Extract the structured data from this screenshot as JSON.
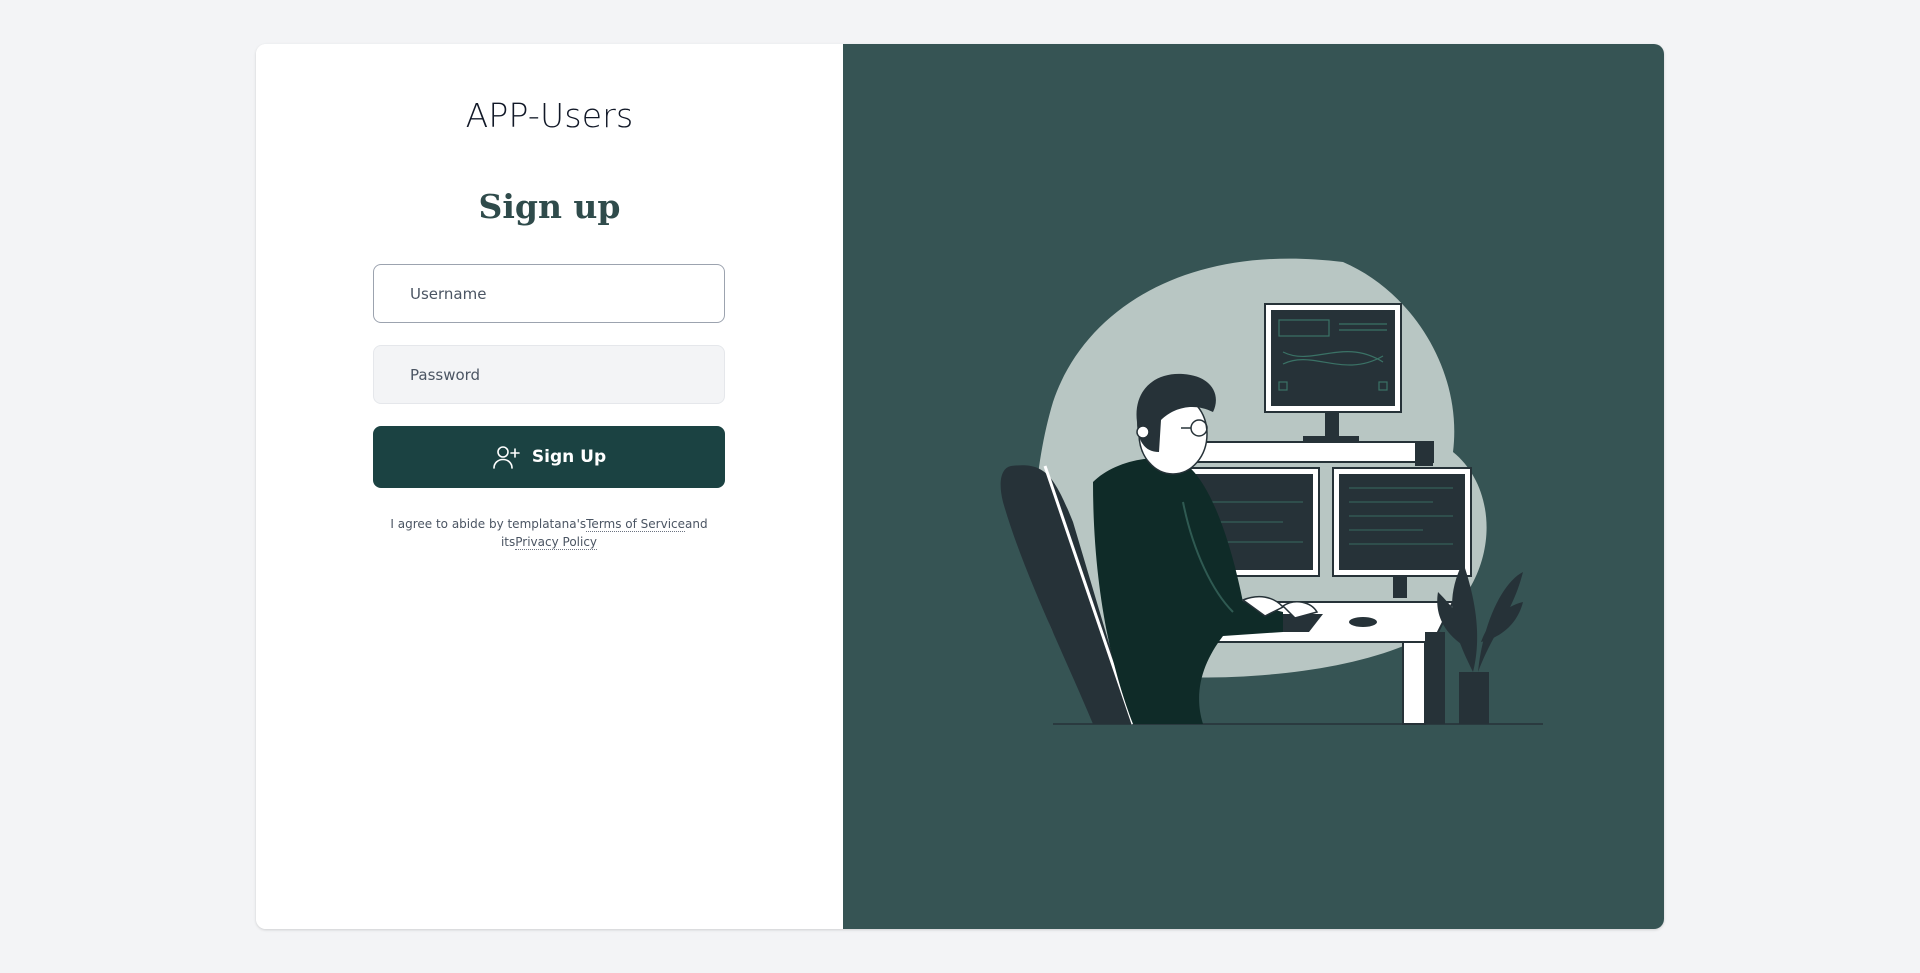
{
  "app": {
    "title": "APP-Users"
  },
  "form": {
    "heading": "Sign up",
    "username_placeholder": "Username",
    "password_placeholder": "Password",
    "submit_label": "Sign Up",
    "submit_icon": "user-plus-icon"
  },
  "terms": {
    "prefix": "I agree to abide by templatana's",
    "terms_link": "Terms of Service",
    "middle": "and its",
    "privacy_link": "Privacy Policy"
  },
  "colors": {
    "page_bg": "#f3f4f6",
    "panel_bg": "#365454",
    "button_bg": "#1b4242",
    "heading": "#2f4b4b"
  }
}
